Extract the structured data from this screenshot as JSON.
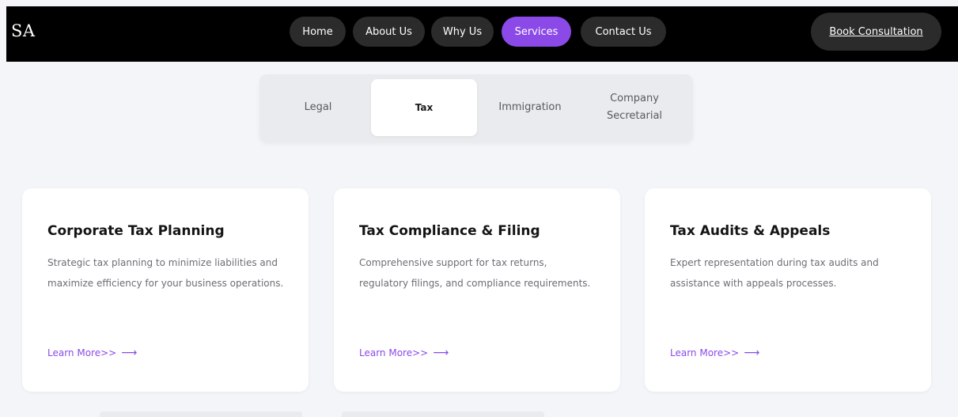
{
  "brand": {
    "logo_text": "SA"
  },
  "nav": {
    "items": [
      {
        "label": "Home"
      },
      {
        "label": "About Us"
      },
      {
        "label": "Why Us"
      },
      {
        "label": "Services",
        "active": true
      },
      {
        "label": "Contact Us"
      }
    ],
    "cta_label": "Book Consultation"
  },
  "tabs": [
    {
      "label": "Legal"
    },
    {
      "label": "Tax",
      "active": true
    },
    {
      "label": "Immigration"
    },
    {
      "label": "Company Secretarial"
    }
  ],
  "cards": [
    {
      "title": "Corporate Tax Planning",
      "description": "Strategic tax planning to minimize liabilities and maximize efficiency for your business operations.",
      "link": "Learn More>>"
    },
    {
      "title": "Tax Compliance & Filing",
      "description": "Comprehensive support for tax returns, regulatory filings, and compliance requirements.",
      "link": "Learn More>>"
    },
    {
      "title": "Tax Audits & Appeals",
      "description": "Expert representation during tax audits and assistance with appeals processes.",
      "link": "Learn More>>"
    }
  ],
  "colors": {
    "accent": "#8b4ae8",
    "nav_background": "#000000",
    "pill_background": "#2b2b2b",
    "page_background": "#f3f5f9"
  },
  "icons": {
    "link_arrow": "arrow-right-icon"
  }
}
